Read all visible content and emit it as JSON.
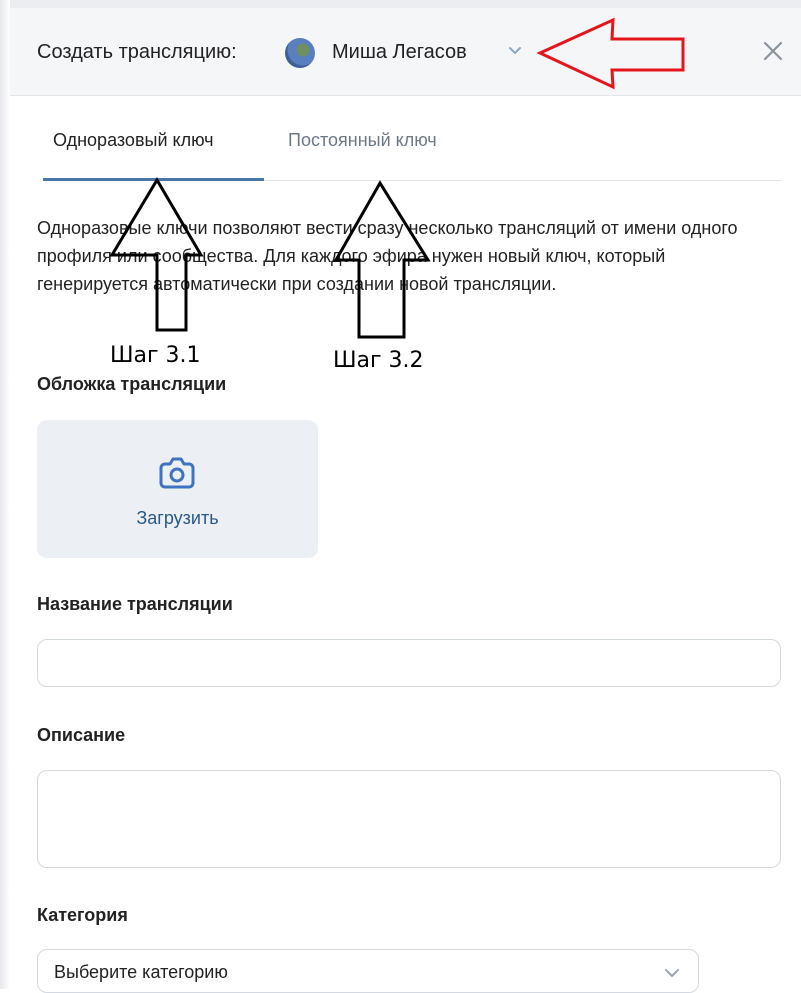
{
  "header": {
    "title": "Создать трансляцию:",
    "owner_name": "Миша Легасов"
  },
  "tabs": [
    {
      "label": "Одноразовый ключ",
      "active": true
    },
    {
      "label": "Постоянный ключ",
      "active": false
    }
  ],
  "description": "Одноразовые ключи позволяют вести сразу несколько трансляций от имени одного профиля или сообщества. Для каждого эфира нужен новый ключ, который генерируется автоматически при создании новой трансляции.",
  "annotations": {
    "step_1": "Шаг 3.1",
    "step_2": "Шаг 3.2"
  },
  "cover": {
    "label": "Обложка трансляции",
    "upload_label": "Загрузить"
  },
  "name_field": {
    "label": "Название трансляции",
    "value": ""
  },
  "description_field": {
    "label": "Описание",
    "value": ""
  },
  "category": {
    "label": "Категория",
    "selected": "Выберите категорию"
  },
  "colors": {
    "accent": "#4a76a8",
    "link": "#2a5885",
    "annotation_arrow": "#e3161d"
  },
  "icons": [
    "avatar",
    "chevron-down-icon",
    "close-icon",
    "camera-icon",
    "chevron-down-icon"
  ]
}
